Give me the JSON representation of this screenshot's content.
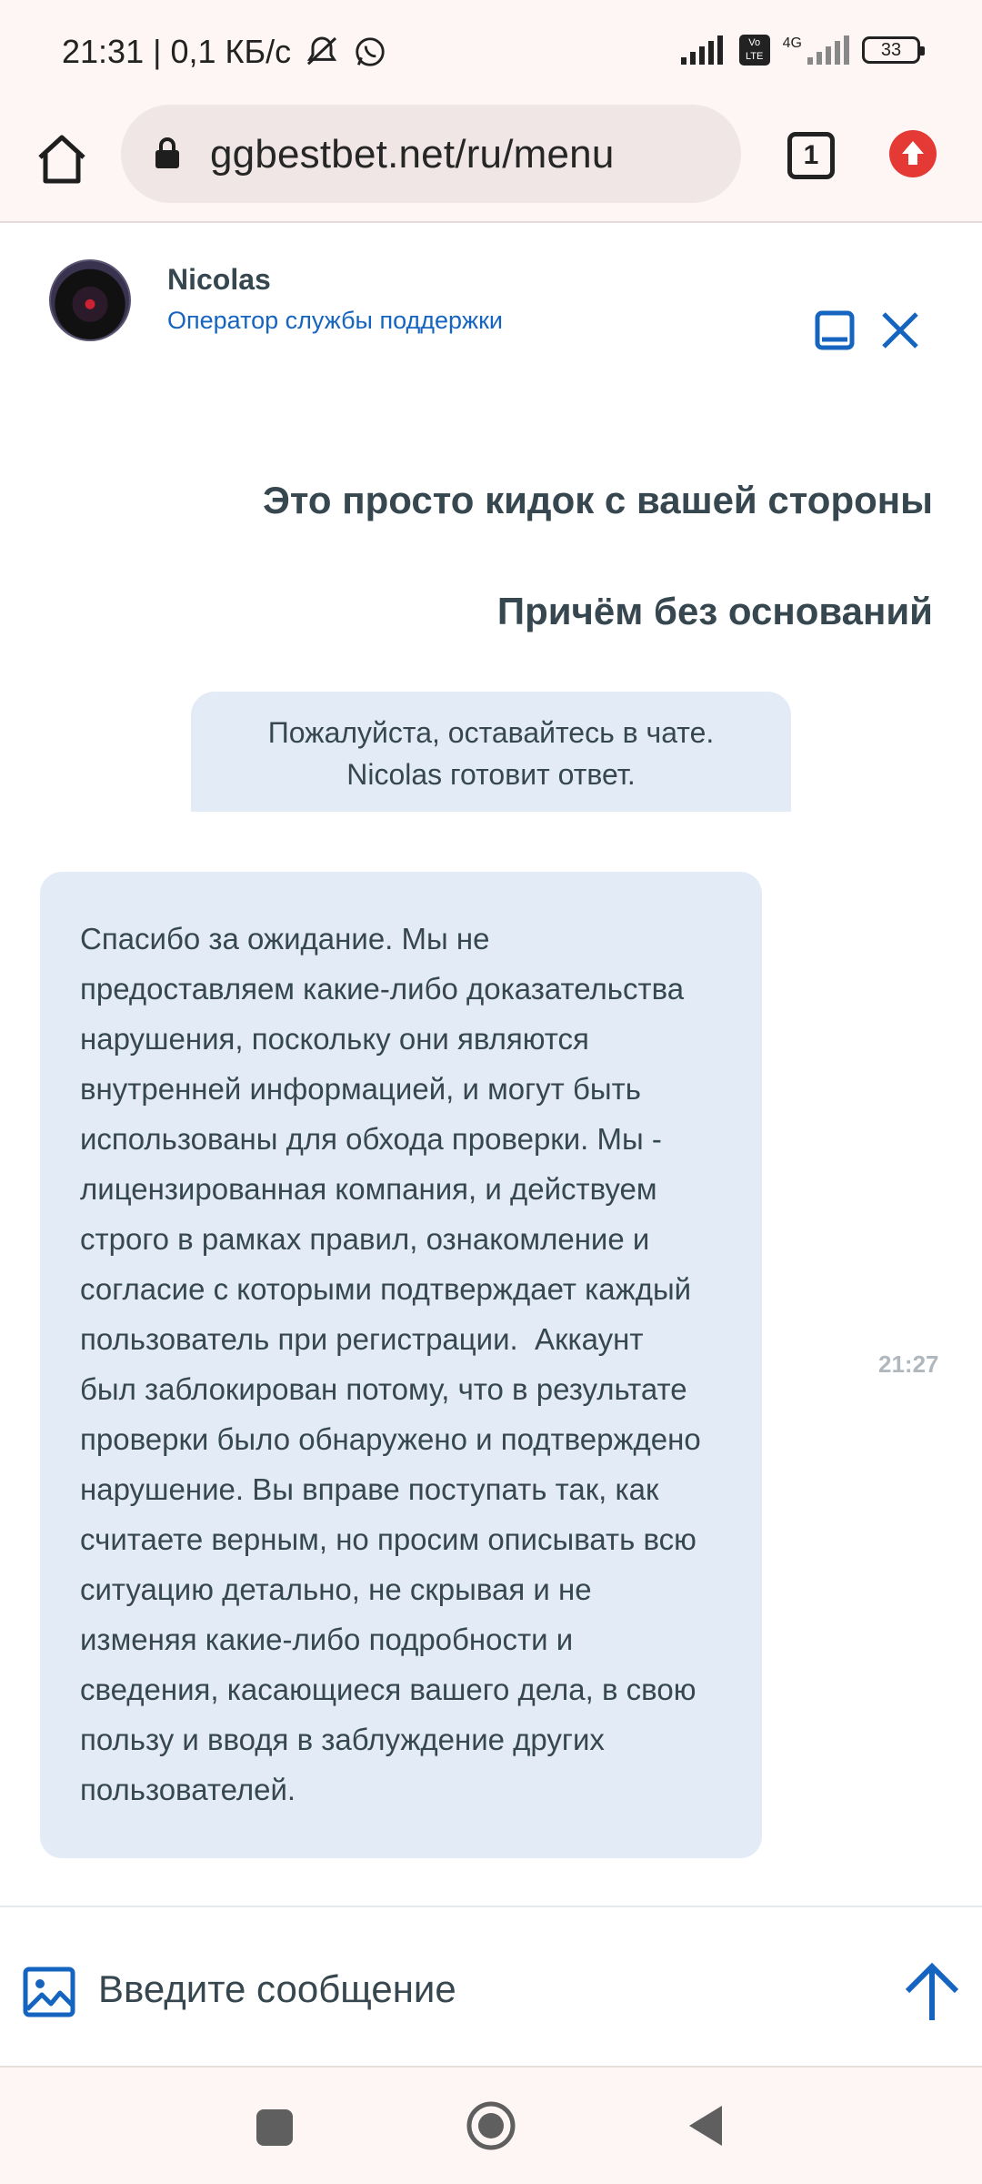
{
  "status_bar": {
    "time_text": "21:31 | 0,1 КБ/с",
    "network_label": "4G",
    "volte_label": "Vo LTE",
    "battery": "33"
  },
  "browser": {
    "url": "ggbestbet.net/ru/menu",
    "tab_count": "1"
  },
  "chat_header": {
    "agent_name": "Nicolas",
    "agent_role": "Оператор службы поддержки"
  },
  "messages": {
    "user_1": "Это просто кидок с вашей стороны",
    "user_2": "Причём без оснований",
    "system_note": "Пожалуйста, оставайтесь в чате.\nNicolas готовит ответ.",
    "operator": "Спасибо за ожидание. Мы не\nпредоставляем какие-либо доказательства\nнарушения, поскольку они являются\nвнутренней информацией, и могут быть\nиспользованы для обхода проверки. Мы -\nлицензированная компания, и действуем\nстрого в рамках правил, ознакомление и\nсогласие с которыми подтверждает каждый\nпользователь при регистрации.  Аккаунт\nбыл заблокирован потому, что в результате\nпроверки было обнаружено и подтверждено\nнарушение. Вы вправе поступать так, как\nсчитаете верным, но просим описывать всю\nситуацию детально, не скрывая и не\nизменяя какие-либо подробности и\nсведения, касающиеся вашего дела, в свою\nпользу и вводя в заблуждение других\nпользователей.",
    "operator_time": "21:27"
  },
  "input": {
    "placeholder": "Введите сообщение",
    "value": ""
  },
  "colors": {
    "accent": "#1565c0",
    "bubble": "#e3ecf6",
    "text": "#37474f",
    "update_badge": "#e53935"
  },
  "icons": [
    "home-icon",
    "lock-icon",
    "tabs-icon",
    "update-icon",
    "minimize-icon",
    "close-icon",
    "image-attach-icon",
    "send-arrow-icon",
    "whatsapp-icon",
    "mute-icon",
    "signal-icon",
    "battery-icon"
  ]
}
